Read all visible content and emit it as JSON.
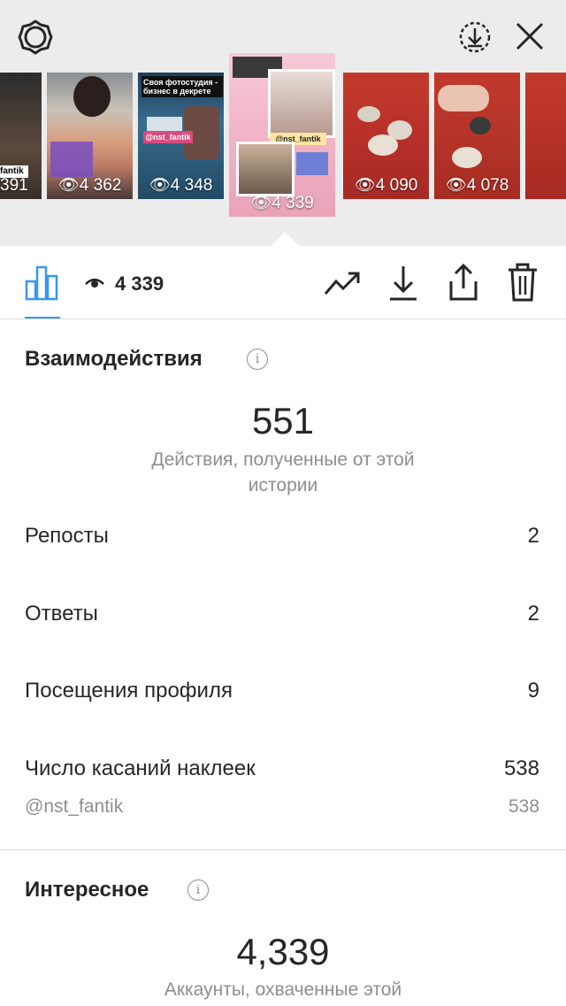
{
  "stories": [
    {
      "views": "391"
    },
    {
      "views": "4 362"
    },
    {
      "views": "4 348",
      "title": "Своя фотостудия - бизнес в декрете",
      "tag": "@nst_fantik"
    },
    {
      "views": "4 339",
      "tag": "@nst_fantik"
    },
    {
      "views": "4 090"
    },
    {
      "views": "4 078"
    }
  ],
  "thumb_partial_text": "fantik",
  "stats_bar": {
    "views": "4 339"
  },
  "interactions": {
    "title": "Взаимодействия",
    "total": "551",
    "total_desc": "Действия, полученные от этой истории",
    "rows": [
      {
        "label": "Репосты",
        "value": "2"
      },
      {
        "label": "Ответы",
        "value": "2"
      },
      {
        "label": "Посещения профиля",
        "value": "9"
      },
      {
        "label": "Число касаний наклеек",
        "value": "538"
      }
    ],
    "sticker": {
      "label": "@nst_fantik",
      "value": "538"
    }
  },
  "discovery": {
    "title": "Интересное",
    "total": "4,339",
    "total_desc": "Аккаунты, охваченные этой"
  },
  "info_glyph": "i",
  "colors": {
    "accent": "#3897f0",
    "top_bg": "#ececec",
    "muted": "#8e8e8e"
  }
}
